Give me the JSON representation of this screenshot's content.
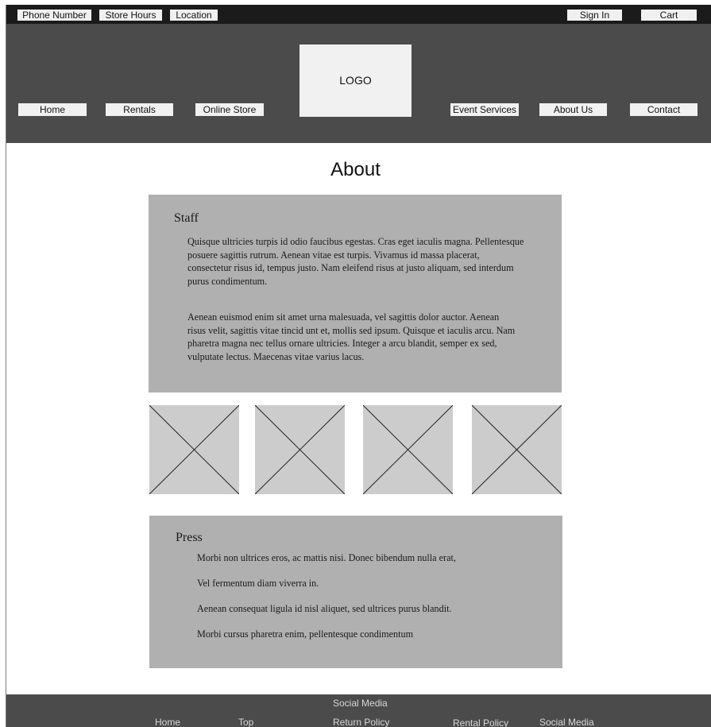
{
  "topbar": {
    "phone": "Phone Number",
    "hours": "Store Hours",
    "location": "Location",
    "signin": "Sign In",
    "cart": "Cart"
  },
  "header": {
    "logo": "LOGO",
    "nav": [
      "Home",
      "Rentals",
      "Online Store",
      "Event Services",
      "About Us",
      "Contact"
    ]
  },
  "main": {
    "title": "About",
    "staff": {
      "heading": "Staff",
      "paragraphs": [
        "Quisque ultricies turpis id odio faucibus egestas. Cras eget iaculis magna. Pellentesque posuere sagittis rutrum. Aenean vitae est turpis. Vivamus id massa placerat, consectetur risus id, tempus justo. Nam eleifend risus at justo aliquam, sed interdum purus condimentum.",
        "Aenean euismod enim sit amet urna malesuada, vel sagittis dolor auctor. Aenean risus velit, sagittis vitae tincid unt et, mollis sed ipsum. Quisque et iaculis arcu. Nam pharetra magna nec tellus ornare ultricies. Integer a arcu blandit, semper ex sed, vulputate lectus. Maecenas vitae varius lacus."
      ]
    },
    "press": {
      "heading": "Press",
      "items": [
        "Morbi non ultrices eros, ac mattis nisi. Donec bibendum nulla erat,",
        "Vel fermentum diam viverra in.",
        "Aenean consequat ligula id nisl aliquet, sed ultrices purus blandit.",
        "Morbi cursus pharetra enim, pellentesque condimentum"
      ]
    }
  },
  "footer": {
    "home": "Home",
    "top": "Top",
    "social_media_top": "Social Media",
    "return_policy": "Return Policy",
    "rental_policy": "Rental Policy",
    "social_media": "Social Media"
  },
  "colors": {
    "topbar": "#1b1b1b",
    "header": "#4b4b4b",
    "panel": "#b0b0b0",
    "placeholder": "#cccccc",
    "button": "#f0f0f0"
  },
  "icons": {
    "image_placeholder": "image-placeholder-icon"
  }
}
